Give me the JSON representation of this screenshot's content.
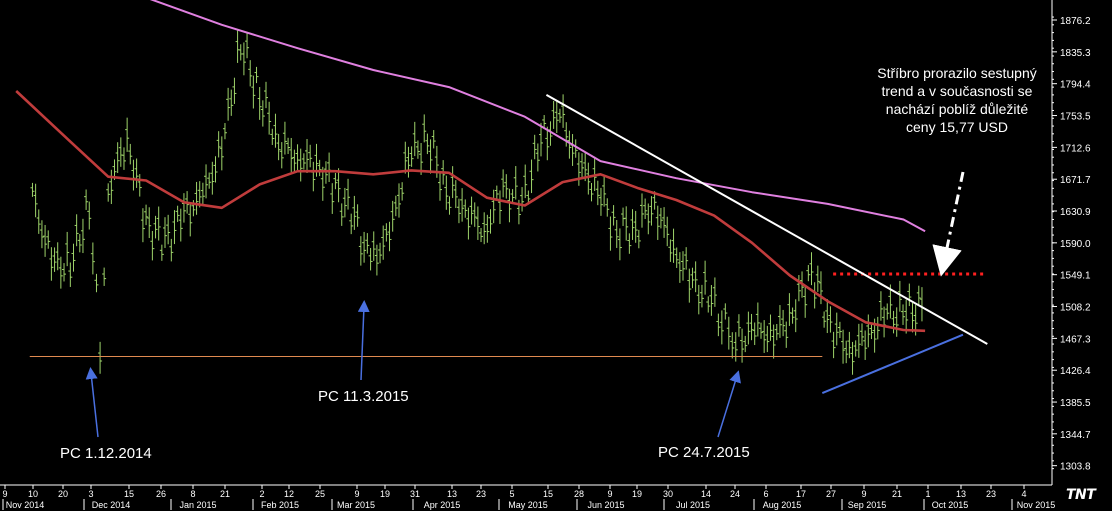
{
  "chart_data": {
    "type": "line",
    "title": "",
    "ylim": [
      1290,
      1895
    ],
    "y_ticks": [
      "1876.2",
      "1835.3",
      "1794.4",
      "1753.5",
      "1712.6",
      "1671.7",
      "1630.9",
      "1590.0",
      "1549.1",
      "1508.2",
      "1467.3",
      "1426.4",
      "1385.5",
      "1344.7",
      "1303.8"
    ],
    "x_day_ticks": [
      "9",
      "10",
      "20",
      "3",
      "15",
      "26",
      "8",
      "21",
      "2",
      "12",
      "25",
      "9",
      "19",
      "31",
      "13",
      "23",
      "5",
      "15",
      "28",
      "9",
      "19",
      "30",
      "14",
      "24",
      "6",
      "17",
      "27",
      "9",
      "21",
      "1",
      "13",
      "23",
      "4"
    ],
    "x_month_labels": [
      "Nov 2014",
      "Dec 2014",
      "Jan 2015",
      "Feb 2015",
      "Mar 2015",
      "Apr 2015",
      "May 2015",
      "Jun 2015",
      "Jul 2015",
      "Aug 2015",
      "Sep 2015",
      "Oct 2015",
      "Nov 2015"
    ],
    "series": [
      {
        "name": "",
        "style": "ohlc",
        "color": "#9ed36a",
        "values": [
          [
            "2014-11-06",
            1650
          ],
          [
            "2014-11-13",
            1565
          ],
          [
            "2014-11-20",
            1560
          ],
          [
            "2014-11-27",
            1640
          ],
          [
            "2014-12-01",
            1455
          ],
          [
            "2014-12-04",
            1660
          ],
          [
            "2014-12-11",
            1725
          ],
          [
            "2014-12-18",
            1615
          ],
          [
            "2014-12-25",
            1590
          ],
          [
            "2015-01-01",
            1625
          ],
          [
            "2015-01-08",
            1650
          ],
          [
            "2015-01-15",
            1710
          ],
          [
            "2015-01-22",
            1845
          ],
          [
            "2015-01-29",
            1780
          ],
          [
            "2015-02-05",
            1720
          ],
          [
            "2015-02-12",
            1700
          ],
          [
            "2015-02-19",
            1690
          ],
          [
            "2015-02-26",
            1660
          ],
          [
            "2015-03-05",
            1620
          ],
          [
            "2015-03-11",
            1565
          ],
          [
            "2015-03-18",
            1600
          ],
          [
            "2015-03-25",
            1700
          ],
          [
            "2015-04-01",
            1725
          ],
          [
            "2015-04-08",
            1660
          ],
          [
            "2015-04-15",
            1635
          ],
          [
            "2015-04-22",
            1605
          ],
          [
            "2015-04-29",
            1660
          ],
          [
            "2015-05-06",
            1640
          ],
          [
            "2015-05-13",
            1720
          ],
          [
            "2015-05-20",
            1755
          ],
          [
            "2015-05-27",
            1690
          ],
          [
            "2015-06-03",
            1660
          ],
          [
            "2015-06-10",
            1605
          ],
          [
            "2015-06-17",
            1610
          ],
          [
            "2015-06-24",
            1640
          ],
          [
            "2015-07-01",
            1580
          ],
          [
            "2015-07-08",
            1540
          ],
          [
            "2015-07-15",
            1515
          ],
          [
            "2015-07-24",
            1460
          ],
          [
            "2015-07-31",
            1480
          ],
          [
            "2015-08-07",
            1470
          ],
          [
            "2015-08-14",
            1500
          ],
          [
            "2015-08-21",
            1555
          ],
          [
            "2015-08-28",
            1485
          ],
          [
            "2015-09-04",
            1450
          ],
          [
            "2015-09-11",
            1470
          ],
          [
            "2015-09-18",
            1500
          ],
          [
            "2015-09-25",
            1500
          ],
          [
            "2015-10-02",
            1510
          ]
        ]
      },
      {
        "name": "",
        "style": "line",
        "color": "#c03c3c",
        "values": [
          [
            "2014-10-31",
            1785
          ],
          [
            "2014-11-20",
            1720
          ],
          [
            "2014-12-04",
            1675
          ],
          [
            "2014-12-18",
            1670
          ],
          [
            "2015-01-01",
            1642
          ],
          [
            "2015-01-15",
            1635
          ],
          [
            "2015-01-29",
            1665
          ],
          [
            "2015-02-12",
            1682
          ],
          [
            "2015-02-26",
            1682
          ],
          [
            "2015-03-12",
            1678
          ],
          [
            "2015-03-26",
            1683
          ],
          [
            "2015-04-09",
            1680
          ],
          [
            "2015-04-23",
            1648
          ],
          [
            "2015-05-07",
            1638
          ],
          [
            "2015-05-21",
            1668
          ],
          [
            "2015-06-04",
            1678
          ],
          [
            "2015-06-18",
            1660
          ],
          [
            "2015-07-02",
            1645
          ],
          [
            "2015-07-16",
            1625
          ],
          [
            "2015-07-30",
            1590
          ],
          [
            "2015-08-13",
            1548
          ],
          [
            "2015-08-27",
            1515
          ],
          [
            "2015-09-10",
            1488
          ],
          [
            "2015-09-24",
            1478
          ],
          [
            "2015-10-02",
            1477
          ]
        ]
      },
      {
        "name": "",
        "style": "line",
        "color": "#e080e0",
        "values": [
          [
            "2014-12-18",
            1905
          ],
          [
            "2015-01-15",
            1870
          ],
          [
            "2015-02-12",
            1840
          ],
          [
            "2015-03-12",
            1812
          ],
          [
            "2015-04-09",
            1790
          ],
          [
            "2015-05-07",
            1752
          ],
          [
            "2015-06-04",
            1695
          ],
          [
            "2015-07-02",
            1673
          ],
          [
            "2015-07-30",
            1655
          ],
          [
            "2015-08-27",
            1640
          ],
          [
            "2015-09-24",
            1620
          ],
          [
            "2015-10-02",
            1605
          ]
        ]
      }
    ],
    "levels": [
      {
        "name": "support",
        "value": 1444,
        "color": "#e08a50",
        "style": "solid",
        "from": "2014-11-05",
        "to": "2015-08-25"
      },
      {
        "name": "resistance",
        "value": 1550,
        "color": "#ff2020",
        "style": "dotted",
        "from": "2015-08-29",
        "to": "2015-10-24"
      }
    ],
    "trendlines": [
      {
        "name": "descending-trendline",
        "color": "#ffffff",
        "from": [
          "2015-05-15",
          1780
        ],
        "to": [
          "2015-10-25",
          1460
        ]
      },
      {
        "name": "rising-trendline",
        "color": "#4a70e0",
        "from": [
          "2015-08-25",
          1397
        ],
        "to": [
          "2015-10-16",
          1472
        ]
      }
    ],
    "annotations": [
      {
        "text": "PC 1.12.2014",
        "date": "2014-12-01"
      },
      {
        "text": "PC 11.3.2015",
        "date": "2015-03-11"
      },
      {
        "text": "PC 24.7.2015",
        "date": "2015-07-24"
      },
      {
        "text": "Stříbro prorazilo sestupný trend a v současnosti se nachází poblíž důležité ceny 15,77 USD"
      }
    ],
    "logo": "TNT",
    "grid": false,
    "legend": "none"
  }
}
